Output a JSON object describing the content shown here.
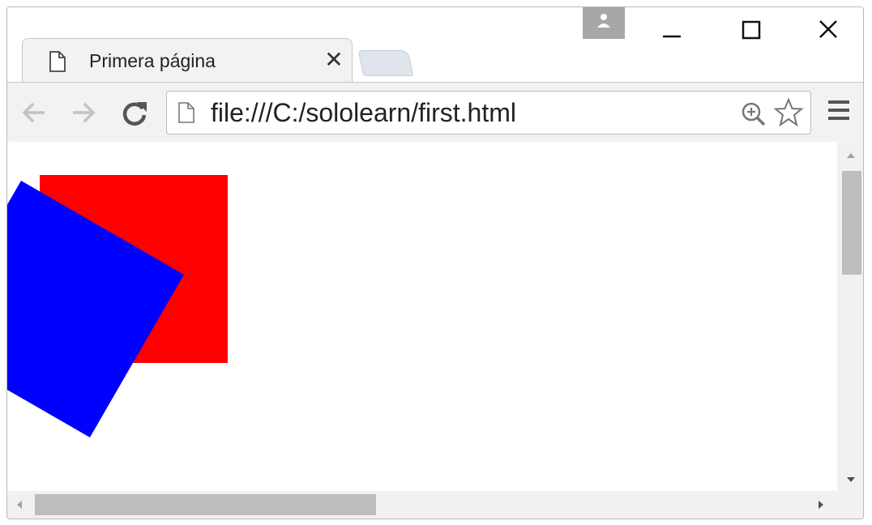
{
  "tab": {
    "title": "Primera página",
    "close_glyph": "✕"
  },
  "address_bar": {
    "url": "file:///C:/sololearn/first.html"
  },
  "icons": {
    "tab_page": "page-icon",
    "url_page": "page-icon",
    "profile": "profile-icon",
    "minimize": "minimize-icon",
    "maximize": "maximize-icon",
    "close": "close-icon",
    "back": "back-arrow-icon",
    "forward": "forward-arrow-icon",
    "reload": "reload-icon",
    "zoom": "zoom-icon",
    "bookmark": "star-icon",
    "menu": "hamburger-menu-icon"
  },
  "content": {
    "red_square_color": "#ff0000",
    "blue_square_color": "#0000ff",
    "blue_rotation_deg": 30
  }
}
